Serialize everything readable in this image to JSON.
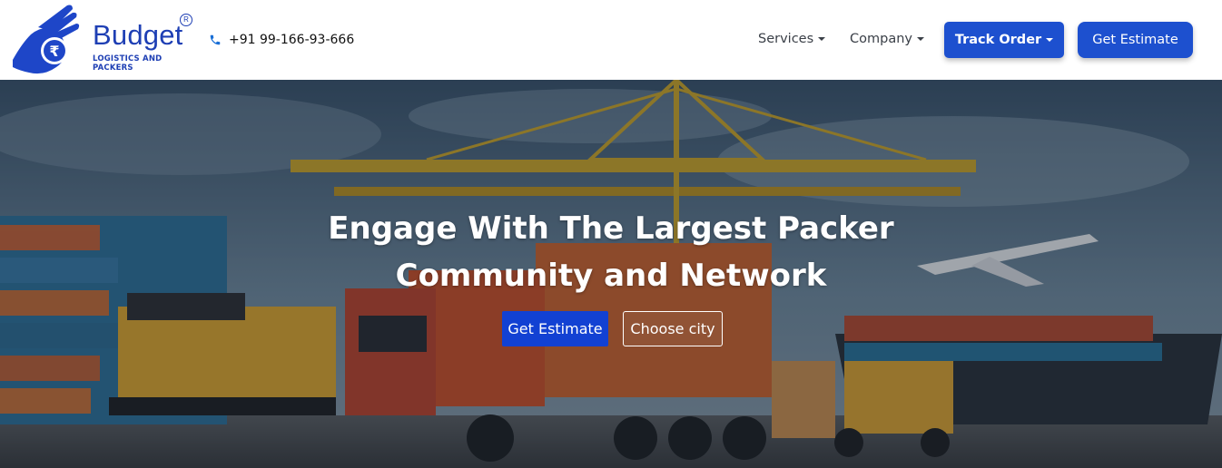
{
  "brand": {
    "name": "Budget",
    "tagline": "LOGISTICS AND PACKERS",
    "registered_mark": "R",
    "color": "#1e3fb4"
  },
  "header": {
    "phone": "+91 99-166-93-666",
    "nav": {
      "services": "Services",
      "company": "Company"
    },
    "track_order": "Track Order",
    "get_estimate": "Get Estimate"
  },
  "hero": {
    "title_line1": "Engage With The Largest Packer",
    "title_line2": "Community and Network",
    "cta_primary": "Get Estimate",
    "cta_secondary": "Choose city"
  },
  "colors": {
    "primary": "#1d50cf",
    "hero_cta": "#1241d3"
  },
  "icons": [
    "logo-hand-rupee-icon",
    "phone-icon",
    "caret-down-icon"
  ]
}
